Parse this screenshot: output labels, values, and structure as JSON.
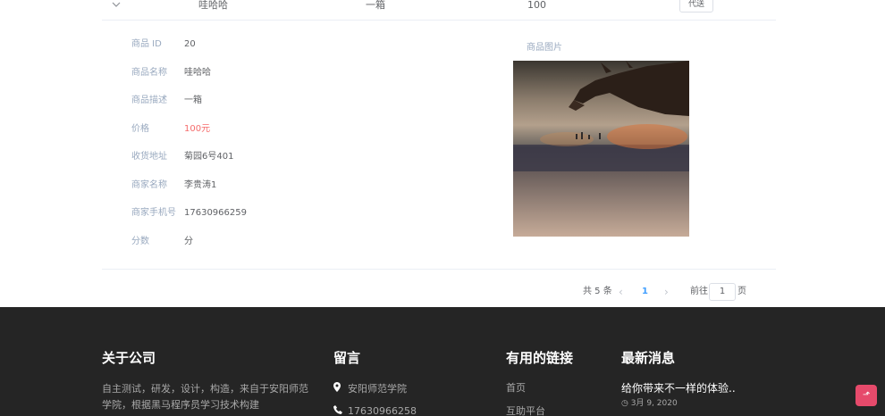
{
  "order_row": {
    "name": "哇哈哈",
    "description": "一箱",
    "price": "100",
    "action_label": "代送"
  },
  "detail": {
    "fields": [
      {
        "label": "商品 ID",
        "value": "20"
      },
      {
        "label": "商品名称",
        "value": "哇哈哈"
      },
      {
        "label": "商品描述",
        "value": "一箱"
      },
      {
        "label": "价格",
        "value": "100元"
      },
      {
        "label": "收货地址",
        "value": "菊园6号401"
      },
      {
        "label": "商家名称",
        "value": "李贵涛1"
      },
      {
        "label": "商家手机号",
        "value": "17630966259"
      },
      {
        "label": "分数",
        "value": "分"
      }
    ],
    "image_label": "商品图片"
  },
  "pagination": {
    "total": "共 5 条",
    "current_page": "1",
    "goto_label": "前往",
    "goto_value": "1",
    "page_suffix": "页"
  },
  "footer": {
    "about": {
      "title": "关于公司",
      "text": "自主测试，研发，设计，构造，来自于安阳师范学院，根据黑马程序员学习技术构建"
    },
    "contact": {
      "title": "留言",
      "address": "安阳师范学院",
      "phone": "17630966258"
    },
    "links": {
      "title": "有用的链接",
      "items": [
        "首页",
        "互助平台"
      ]
    },
    "news": {
      "title": "最新消息",
      "item_title": "给你带来不一样的体验..",
      "item_date": "3月 9, 2020"
    }
  },
  "colors": {
    "price": "#f56c6c",
    "accent": "#409eff",
    "footer_bg": "#252525",
    "back_to_top": "#e64a6b"
  },
  "icons": {
    "expand": "chevron-down-icon",
    "pin": "map-pin-icon",
    "phone": "phone-icon",
    "clock": "clock-icon",
    "top": "arrow-up-icon"
  }
}
